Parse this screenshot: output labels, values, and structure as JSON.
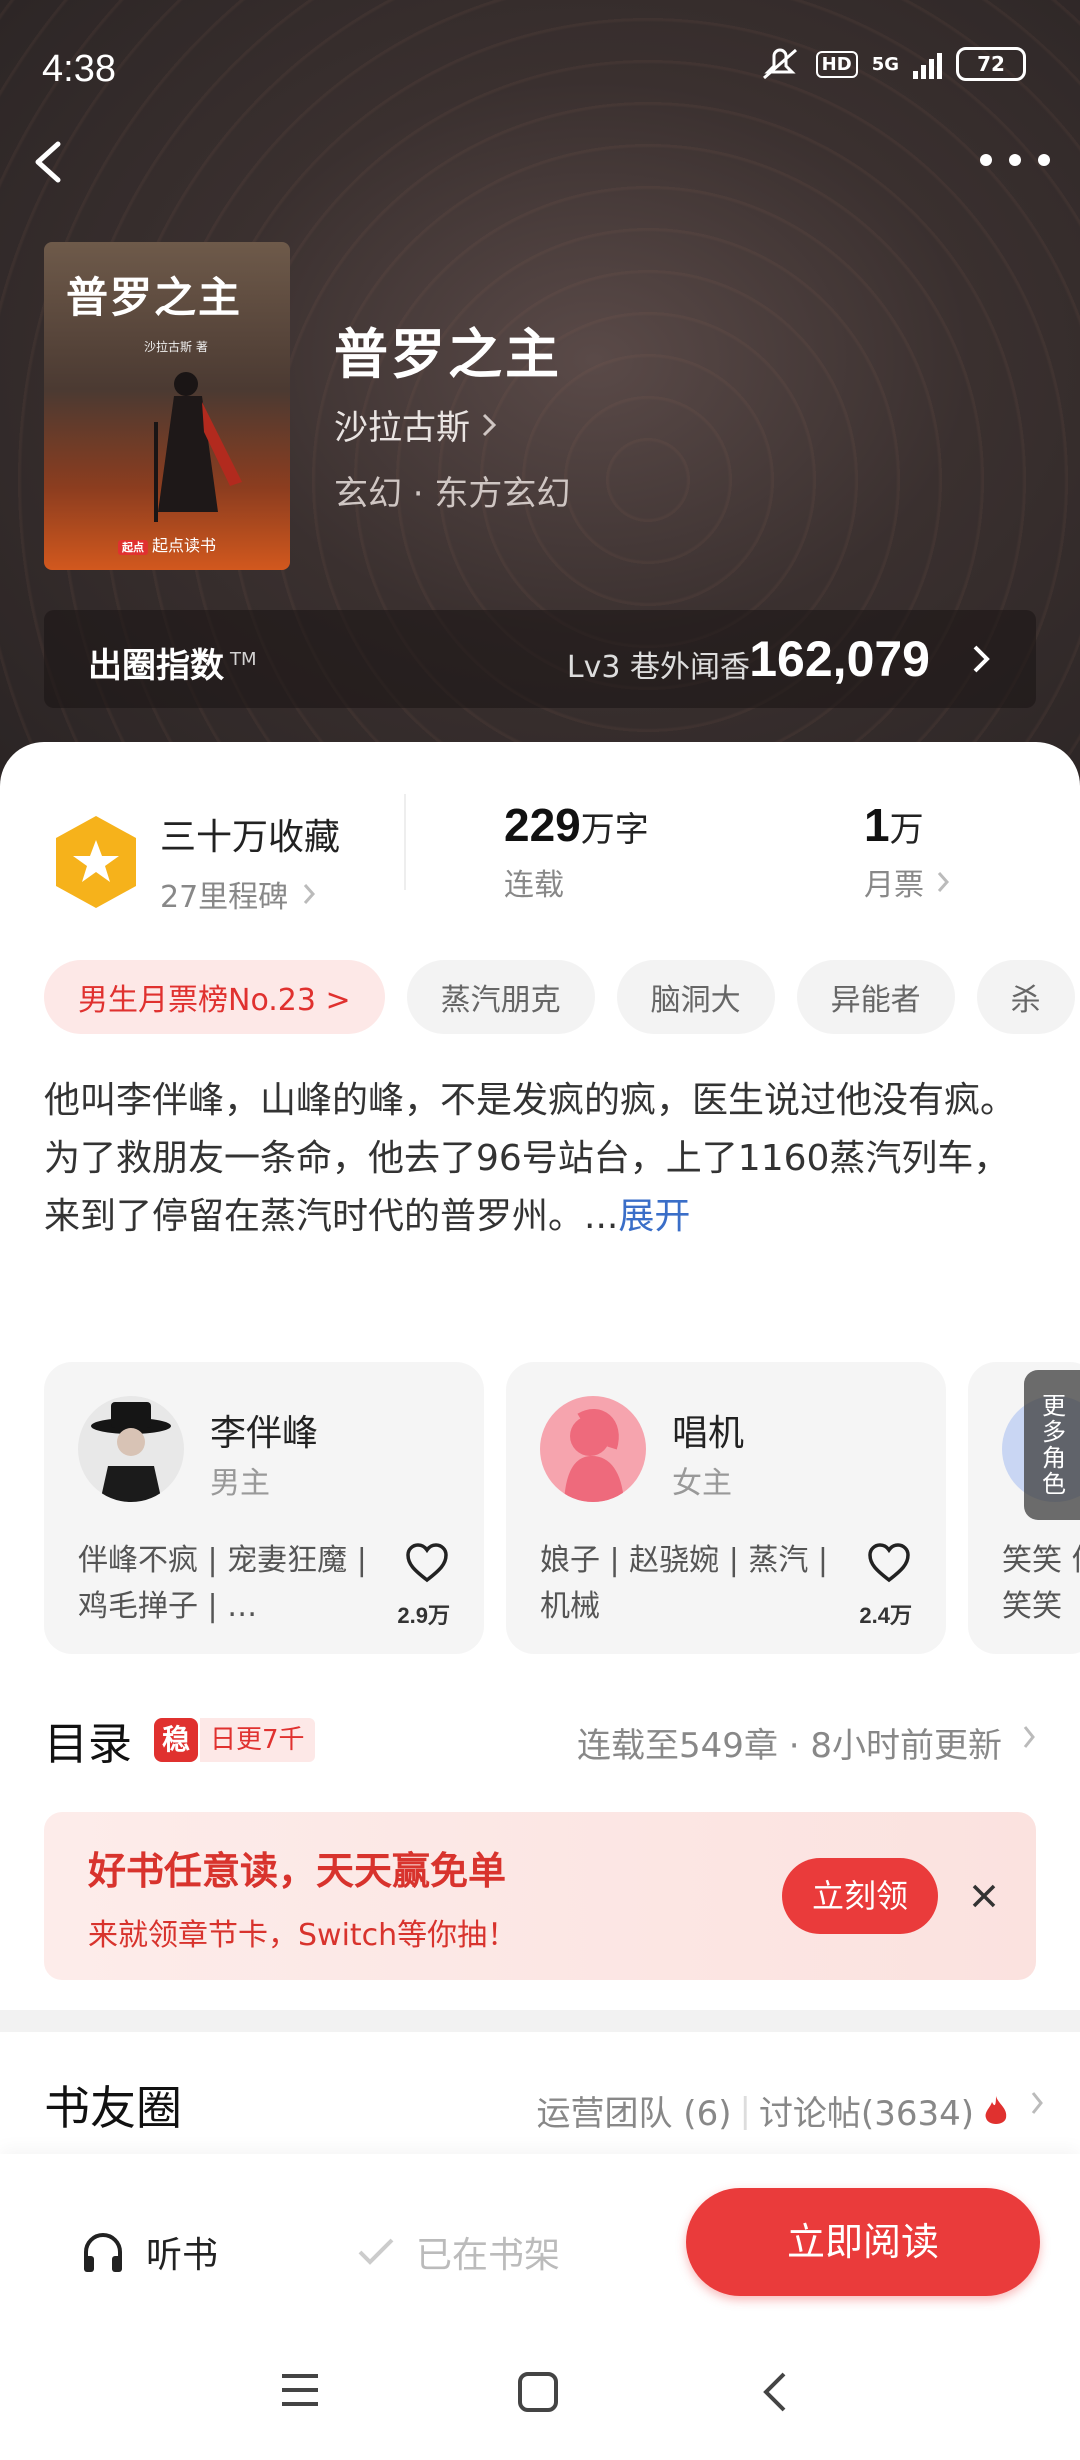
{
  "status_bar": {
    "time": "4:38",
    "hd": "HD",
    "network": "5G",
    "battery": "72"
  },
  "book": {
    "cover_title": "普罗之主",
    "cover_author": "沙拉古斯 著",
    "cover_publisher_badge": "起点",
    "cover_publisher": "起点读书",
    "title": "普罗之主",
    "author": "沙拉古斯",
    "genre": "玄幻 · 东方玄幻"
  },
  "influence": {
    "label": "出圈指数",
    "tm": "TM",
    "level": "Lv3 巷外闻香",
    "value": "162,079"
  },
  "stats": {
    "milestone_title": "三十万收藏",
    "milestone_sub": "27里程碑",
    "words_num": "229",
    "words_unit": "万字",
    "words_label": "连载",
    "tickets_num": "1",
    "tickets_unit": "万",
    "tickets_label": "月票"
  },
  "tags": [
    "男生月票榜No.23 >",
    "蒸汽朋克",
    "脑洞大",
    "异能者",
    "杀"
  ],
  "description": {
    "text": "他叫李伴峰，山峰的峰，不是发疯的疯，医生说过他没有疯。\n为了救朋友一条命，他去了96号站台，上了1160蒸汽列车，来到了停留在蒸汽时代的普罗州。...",
    "expand": "展开"
  },
  "roles": [
    {
      "name": "李伴峰",
      "type": "男主",
      "desc": "伴峰不疯 | 宠妻狂魔 | 鸡毛掸子 | …",
      "likes": "2.9万"
    },
    {
      "name": "唱机",
      "type": "女主",
      "desc": "娘子 | 赵骁婉 | 蒸汽 | 机械",
      "likes": "2.4万"
    },
    {
      "name": "",
      "type": "",
      "desc": "笑笑 何笑笑",
      "likes": ""
    }
  ],
  "more_roles": "更多角色",
  "toc": {
    "title": "目录",
    "badge": "稳",
    "update_badge": "日更7千",
    "status": "连载至549章 · 8小时前更新"
  },
  "promo": {
    "title": "好书任意读，天天赢免单",
    "subtitle": "来就领章节卡，Switch等你抽！",
    "cta": "立刻领"
  },
  "circle": {
    "title": "书友圈",
    "team": "运营团队 (6)",
    "posts": "讨论帖(3634)"
  },
  "bottom": {
    "listen": "听书",
    "shelf": "已在书架",
    "read": "立即阅读"
  },
  "colors": {
    "accent": "#ea3b3b",
    "link": "#3a6ec8",
    "gold": "#f6b21b"
  }
}
